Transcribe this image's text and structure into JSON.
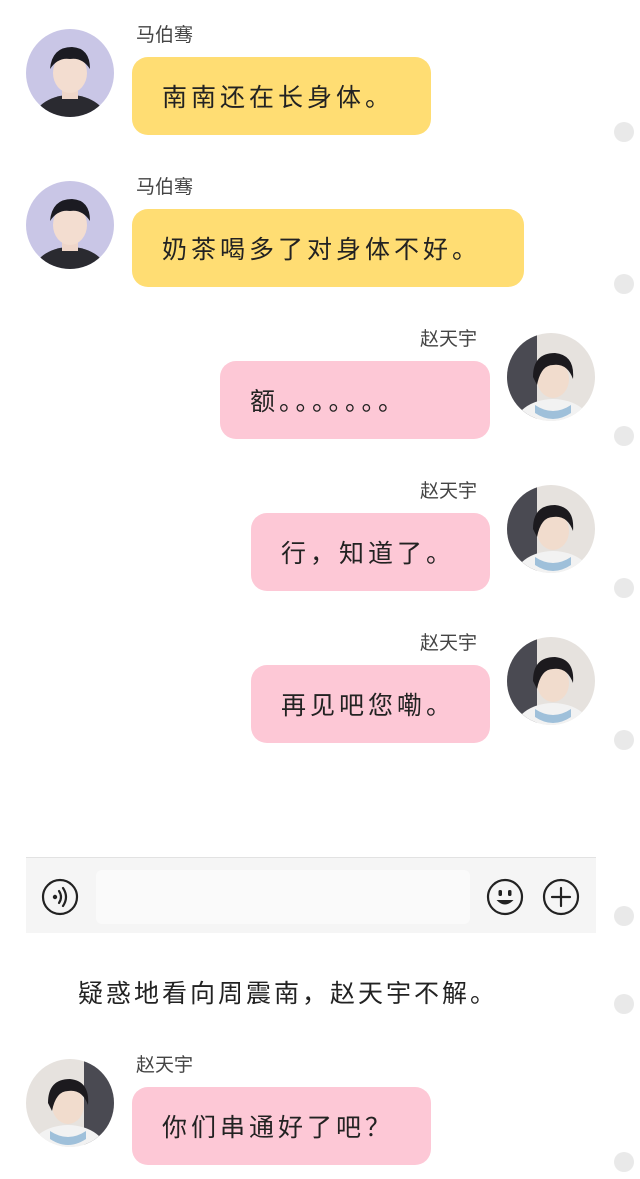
{
  "messages": [
    {
      "sender": "马伯骞",
      "text": "南南还在长身体。",
      "side": "left",
      "bubble_color": "#ffdd73"
    },
    {
      "sender": "马伯骞",
      "text": "奶茶喝多了对身体不好。",
      "side": "left",
      "bubble_color": "#ffdd73"
    },
    {
      "sender": "赵天宇",
      "text": "额。。。。。。。",
      "side": "right",
      "bubble_color": "#fdc8d6"
    },
    {
      "sender": "赵天宇",
      "text": "行，知道了。",
      "side": "right",
      "bubble_color": "#fdc8d6"
    },
    {
      "sender": "赵天宇",
      "text": "再见吧您嘞。",
      "side": "right",
      "bubble_color": "#fdc8d6"
    }
  ],
  "input_bar": {
    "voice_icon": "voice-icon",
    "emoji_icon": "emoji-icon",
    "add_icon": "plus-icon",
    "input_value": ""
  },
  "narration": "疑惑地看向周震南，赵天宇不解。",
  "last_message": {
    "sender": "赵天宇",
    "text": "你们串通好了吧？",
    "side": "left",
    "bubble_color": "#fdc8d6"
  }
}
